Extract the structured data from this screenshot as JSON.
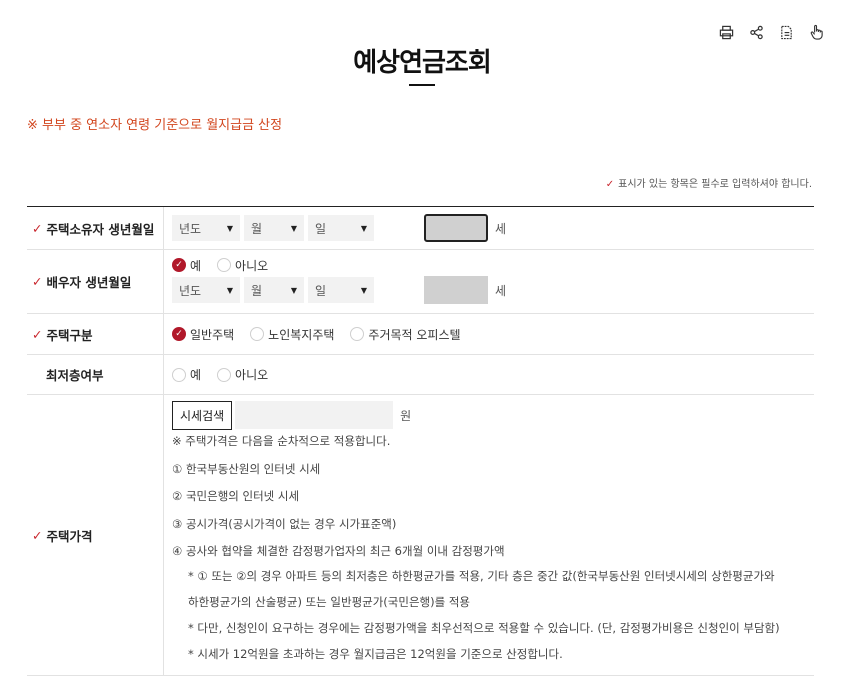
{
  "toolbar": {
    "icons": [
      "print-icon",
      "share-icon",
      "document-icon",
      "hand-cursor-icon"
    ]
  },
  "title": "예상연금조회",
  "notice": "※ 부부 중 연소자 연령 기준으로 월지급금 산정",
  "required_notice": "표시가 있는 항목은 필수로 입력하셔야 합니다.",
  "rows": {
    "owner_birth": {
      "label": "주택소유자 생년월일",
      "year": "년도",
      "month": "월",
      "day": "일",
      "unit": "세"
    },
    "spouse_birth": {
      "label": "배우자 생년월일",
      "yes": "예",
      "no": "아니오",
      "year": "년도",
      "month": "월",
      "day": "일",
      "unit": "세"
    },
    "house_type": {
      "label": "주택구분",
      "options": [
        "일반주택",
        "노인복지주택",
        "주거목적 오피스텔"
      ],
      "selected": "일반주택"
    },
    "lowest_floor": {
      "label": "최저층여부",
      "yes": "예",
      "no": "아니오"
    },
    "house_price": {
      "label": "주택가격",
      "search_button": "시세검색",
      "unit": "원",
      "notes": [
        "※ 주택가격은 다음을 순차적으로 적용합니다.",
        "① 한국부동산원의 인터넷 시세",
        "② 국민은행의 인터넷 시세",
        "③ 공시가격(공시가격이 없는 경우 시가표준액)",
        "④ 공사와 협약을 체결한 감정평가업자의 최근 6개월 이내 감정평가액"
      ],
      "subnotes": [
        "* ① 또는 ②의 경우 아파트 등의 최저층은 하한평균가를 적용, 기타 층은 중간 값(한국부동산원 인터넷시세의 상한평균가와",
        "하한평균가의 산술평균) 또는 일반평균가(국민은행)를 적용",
        "* 다만, 신청인이 요구하는 경우에는 감정평가액을 최우선적으로 적용할 수 있습니다. (단, 감정평가비용은 신청인이 부담함)",
        "* 시세가 12억원을 초과하는 경우 월지급금은 12억원을 기준으로 산정합니다."
      ]
    }
  }
}
